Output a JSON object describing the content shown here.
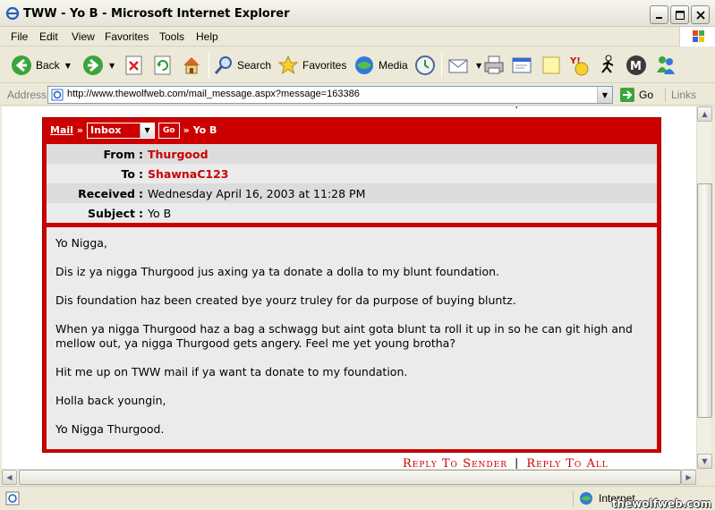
{
  "window": {
    "title": "TWW - Yo B - Microsoft Internet Explorer"
  },
  "menu": [
    "File",
    "Edit",
    "View",
    "Favorites",
    "Tools",
    "Help"
  ],
  "toolbar": {
    "back": "Back",
    "search": "Search",
    "favorites": "Favorites",
    "media": "Media"
  },
  "address": {
    "label": "Address",
    "url": "http://www.thewolfweb.com/mail_message.aspx?message=163386",
    "go": "Go",
    "links": "Links"
  },
  "page": {
    "reply_sender": "Reply To Sender",
    "reply_all": "Reply To All",
    "separator": "|",
    "nav": {
      "mail_link": "Mail",
      "arrows": "»",
      "folder_selected": "Inbox",
      "go_button": "Go",
      "subject_crumb": "Yo B"
    },
    "headers": {
      "from_label": "From",
      "from_value": "Thurgood",
      "to_label": "To",
      "to_value": "ShawnaC123",
      "received_label": "Received",
      "received_value": "Wednesday April 16, 2003 at 11:28 PM",
      "subject_label": "Subject",
      "subject_value": "Yo B",
      "colon": ":"
    },
    "body": [
      "Yo Nigga,",
      "Dis iz ya nigga Thurgood jus axing ya ta donate a dolla to my blunt foundation.",
      "Dis foundation haz been created bye yourz truley for da purpose of buying bluntz.",
      "When ya nigga Thurgood haz a bag a schwagg but aint gota blunt ta roll it up in so he can git high and mellow out, ya nigga Thurgood gets angery. Feel me yet young brotha?",
      "Hit me up on TWW mail if ya want ta donate to my foundation.",
      "Holla back youngin,",
      "Yo Nigga Thurgood."
    ]
  },
  "status": {
    "zone": "Internet",
    "watermark": "thewolfweb.com"
  },
  "colors": {
    "accent": "#cc0000",
    "chrome": "#ece9d8"
  }
}
